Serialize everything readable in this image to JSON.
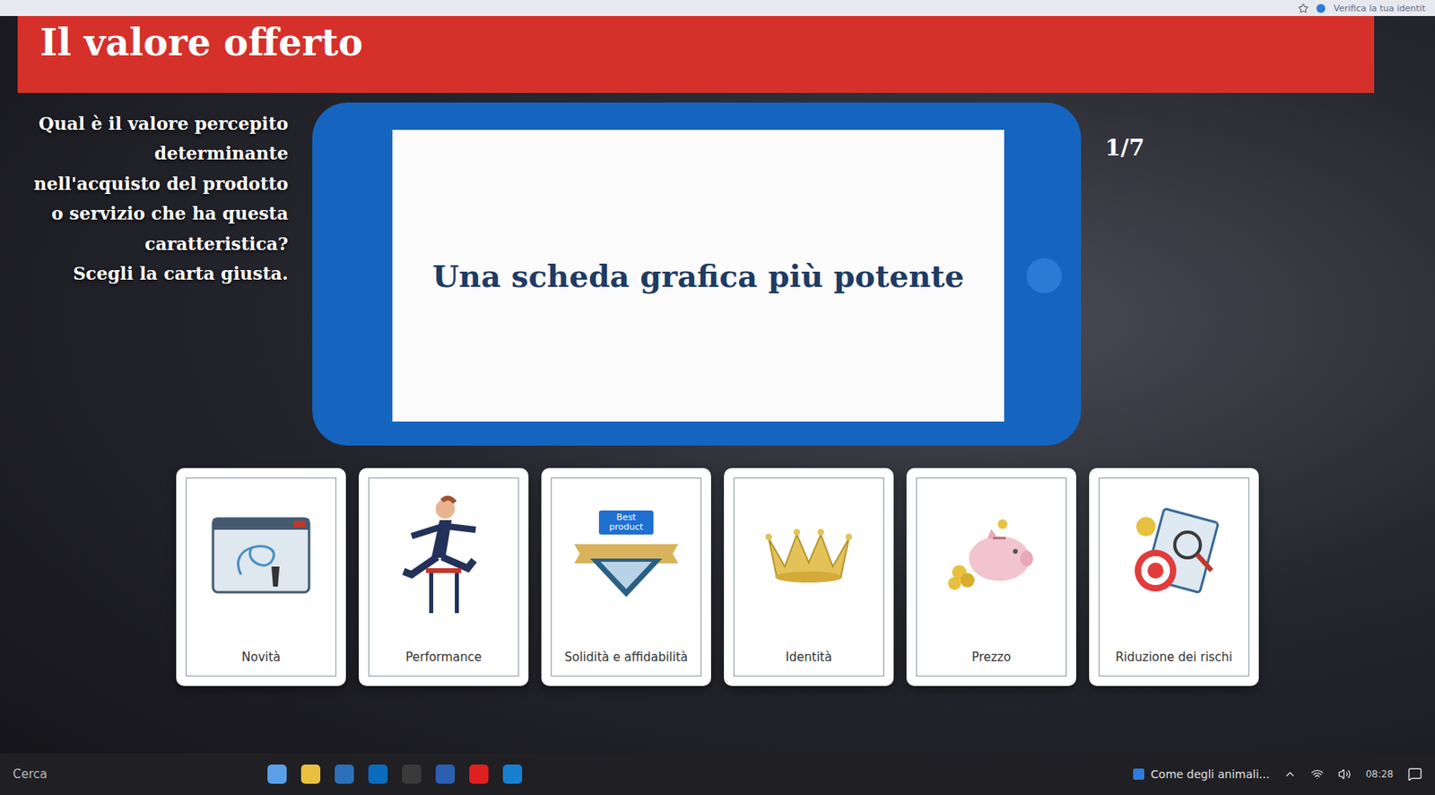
{
  "browser": {
    "notice": "Verifica la tua identit"
  },
  "header": {
    "title": "Il valore offerto"
  },
  "question": {
    "text": "Qual è il valore percepito determinante nell'acquisto del prodotto o servizio che ha questa caratteristica?",
    "instruction": "Scegli la carta giusta."
  },
  "tablet": {
    "statement": "Una scheda grafica più potente"
  },
  "counter": "1/7",
  "cards": [
    {
      "label": "Novità",
      "kind": "novelty"
    },
    {
      "label": "Performance",
      "kind": "performance"
    },
    {
      "label": "Solidità e affidabilità",
      "kind": "badge",
      "badge": "Best product"
    },
    {
      "label": "Identità",
      "kind": "crown"
    },
    {
      "label": "Prezzo",
      "kind": "piggy"
    },
    {
      "label": "Riduzione dei rischi",
      "kind": "target"
    }
  ],
  "taskbar": {
    "search": "Cerca",
    "media": "Come degli animali...",
    "time": "08:28"
  }
}
